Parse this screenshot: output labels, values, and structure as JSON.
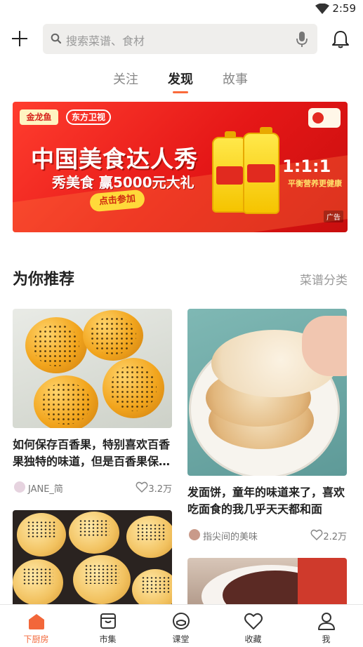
{
  "status_bar": {
    "time": "2:59"
  },
  "header": {
    "search_placeholder": "搜索菜谱、食材"
  },
  "tabs": [
    {
      "label": "关注",
      "active": false
    },
    {
      "label": "发现",
      "active": true
    },
    {
      "label": "故事",
      "active": false
    }
  ],
  "banner": {
    "brand_left": "金龙鱼",
    "brand_partner": "东方卫视",
    "title": "中国美食达人秀",
    "subtitle": "秀美食 赢5000元大礼",
    "cta": "点击参加",
    "bottle_label": "金龙鱼",
    "offer": "1:1:1",
    "offer_sub": "平衡营养更健康",
    "ad_tag": "广告"
  },
  "section": {
    "title": "为你推荐",
    "link": "菜谱分类"
  },
  "cards": [
    {
      "title": "如何保存百香果，特别喜欢百香果独特的味道，但是百香果保存时间不长",
      "author": "JANE_简",
      "likes": "3.2万"
    },
    {
      "title": "发面饼，童年的味道来了，喜欢吃面食的我几乎天天都和面",
      "author": "指尖间的美味",
      "likes": "2.2万"
    }
  ],
  "bottom_nav": [
    {
      "label": "下厨房",
      "icon": "home-icon",
      "active": true
    },
    {
      "label": "市集",
      "icon": "market-icon",
      "active": false
    },
    {
      "label": "课堂",
      "icon": "class-icon",
      "active": false
    },
    {
      "label": "收藏",
      "icon": "heart-icon",
      "active": false
    },
    {
      "label": "我",
      "icon": "profile-icon",
      "active": false
    }
  ],
  "colors": {
    "accent": "#f2673a",
    "banner_red": "#e51717"
  }
}
